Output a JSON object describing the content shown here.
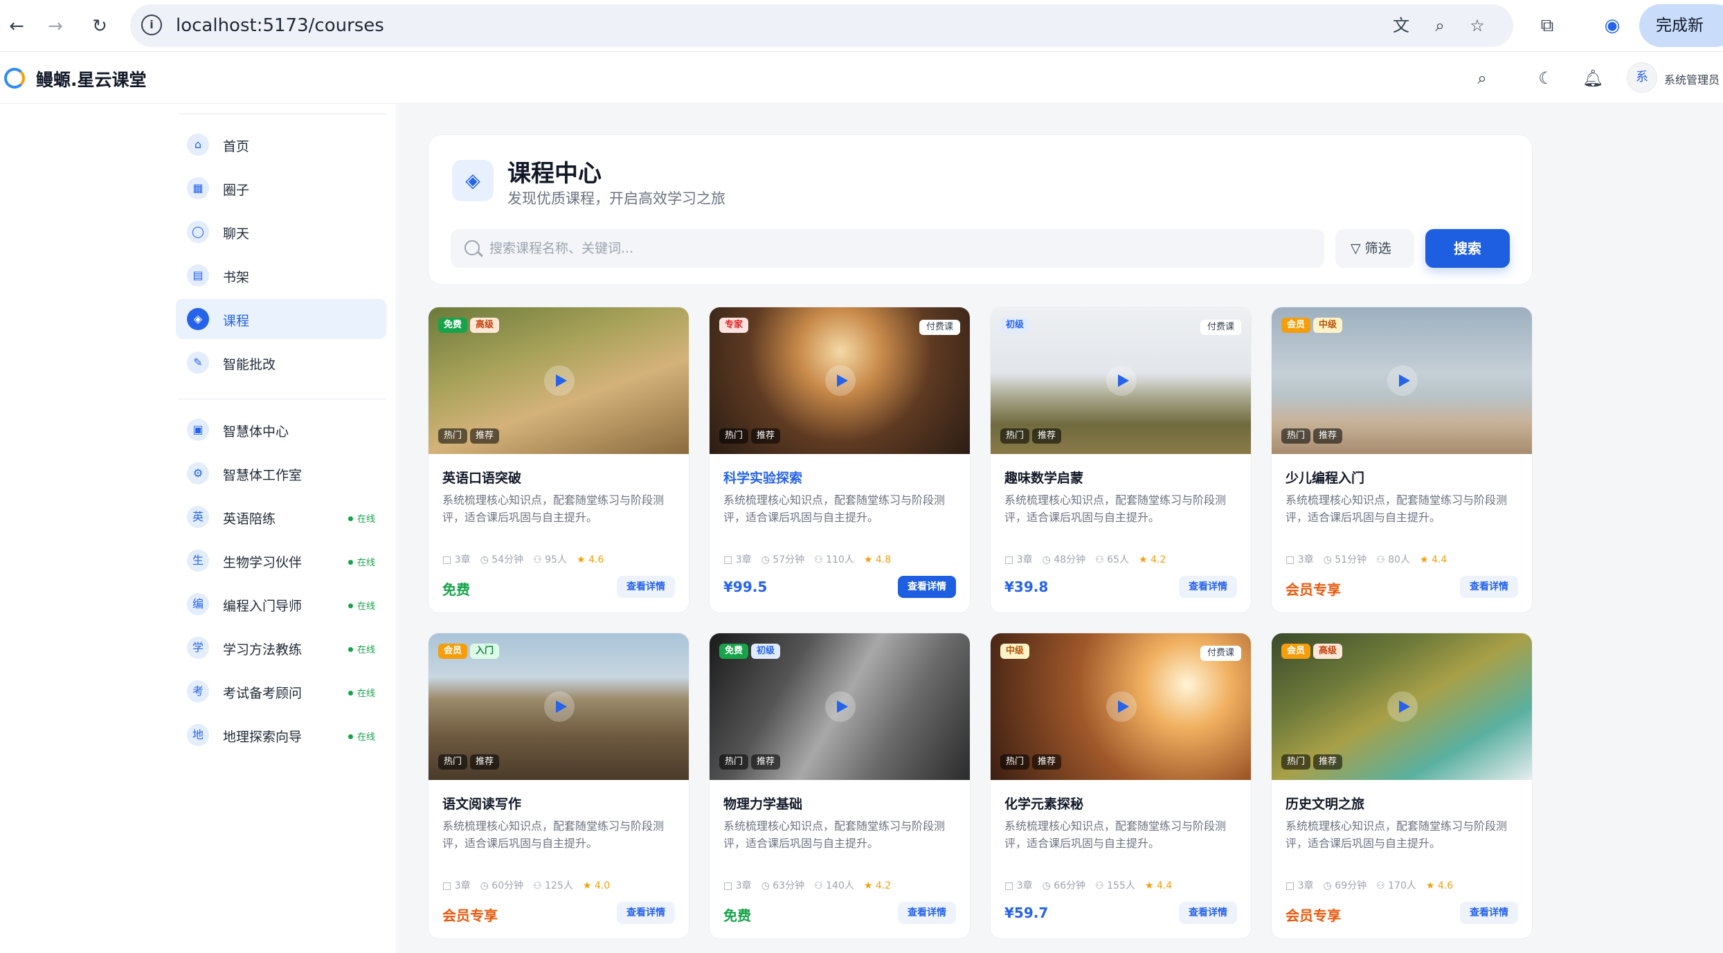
{
  "browser": {
    "url": "localhost:5173/courses",
    "update_label": "完成新"
  },
  "app": {
    "brand": "鳗螈.星云课堂",
    "user_avatar": "系",
    "user_name": "系统管理员"
  },
  "sidebar": {
    "primary": [
      {
        "icon": "home-icon",
        "glyph": "⌂",
        "label": "首页"
      },
      {
        "icon": "grid-icon",
        "glyph": "▦",
        "label": "圈子"
      },
      {
        "icon": "chat-icon",
        "glyph": "◯",
        "label": "聊天"
      },
      {
        "icon": "book-icon",
        "glyph": "▤",
        "label": "书架"
      },
      {
        "icon": "graduation-cap-icon",
        "glyph": "◈",
        "label": "课程",
        "active": true
      },
      {
        "icon": "pen-icon",
        "glyph": "✎",
        "label": "智能批改"
      }
    ],
    "agents": [
      {
        "icon": "robot-icon",
        "glyph": "▣",
        "label": "智慧体中心"
      },
      {
        "icon": "sliders-icon",
        "glyph": "⚙",
        "label": "智慧体工作室"
      },
      {
        "glyph": "英",
        "label": "英语陪练",
        "status": "在线"
      },
      {
        "glyph": "生",
        "label": "生物学习伙伴",
        "status": "在线"
      },
      {
        "glyph": "编",
        "label": "编程入门导师",
        "status": "在线"
      },
      {
        "glyph": "学",
        "label": "学习方法教练",
        "status": "在线"
      },
      {
        "glyph": "考",
        "label": "考试备考顾问",
        "status": "在线"
      },
      {
        "glyph": "地",
        "label": "地理探索向导",
        "status": "在线"
      }
    ]
  },
  "hero": {
    "title": "课程中心",
    "subtitle": "发现优质课程，开启高效学习之旅",
    "search_placeholder": "搜索课程名称、关键词...",
    "filter_label": "筛选",
    "search_label": "搜索"
  },
  "courses": [
    {
      "title": "英语口语突破",
      "tags": [
        {
          "text": "免费",
          "kind": "free"
        },
        {
          "text": "高级",
          "kind": "adv"
        }
      ],
      "pay_tag": "",
      "hot": [
        "热门",
        "推荐"
      ],
      "desc": "系统梳理核心知识点，配套随堂练习与阶段测评，适合课后巩固与自主提升。",
      "chapters": "3章",
      "duration": "54分钟",
      "students": "95人",
      "rating": "4.6",
      "price": "免费",
      "price_kind": "free",
      "detail": "查看详情",
      "bg": "linear-gradient(160deg,#6b7a3a 0%,#a8a25a 35%,#d4b27a 60%,#8a6a3e 100%)"
    },
    {
      "title": "科学实验探索",
      "tags": [
        {
          "text": "专家",
          "kind": "expert"
        }
      ],
      "pay_tag": "付费课",
      "hot": [
        "热门",
        "推荐"
      ],
      "desc": "系统梳理核心知识点，配套随堂练习与阶段测评，适合课后巩固与自主提升。",
      "chapters": "3章",
      "duration": "57分钟",
      "students": "110人",
      "rating": "4.8",
      "price": "¥99.5",
      "price_kind": "num",
      "detail": "查看详情",
      "bg": "radial-gradient(circle at 50% 30%,#f5d9a6 0%,#c88a4a 25%,#5e3a22 55%,#2a1c14 100%)",
      "title_link": true,
      "detail_primary": true
    },
    {
      "title": "趣味数学启蒙",
      "tags": [
        {
          "text": "初级",
          "kind": "basic"
        }
      ],
      "pay_tag": "付费课",
      "hot": [
        "热门",
        "推荐"
      ],
      "desc": "系统梳理核心知识点，配套随堂练习与阶段测评，适合课后巩固与自主提升。",
      "chapters": "3章",
      "duration": "48分钟",
      "students": "65人",
      "rating": "4.2",
      "price": "¥39.8",
      "price_kind": "num",
      "detail": "查看详情",
      "bg": "linear-gradient(180deg,#eef0f3 0%,#e2e6ea 45%,#a7a48a 62%,#6f6a3e 80%,#8a7a48 100%)"
    },
    {
      "title": "少儿编程入门",
      "tags": [
        {
          "text": "会员",
          "kind": "vip"
        },
        {
          "text": "中级",
          "kind": "mid"
        }
      ],
      "pay_tag": "",
      "hot": [
        "热门",
        "推荐"
      ],
      "desc": "系统梳理核心知识点，配套随堂练习与阶段测评，适合课后巩固与自主提升。",
      "chapters": "3章",
      "duration": "51分钟",
      "students": "80人",
      "rating": "4.4",
      "price": "会员专享",
      "price_kind": "vip",
      "detail": "查看详情",
      "bg": "linear-gradient(180deg,#9db0c0 0%,#c5cfd6 45%,#b9c4c9 60%,#c7b39a 78%,#a88c6e 100%)"
    },
    {
      "title": "语文阅读写作",
      "tags": [
        {
          "text": "会员",
          "kind": "vip"
        },
        {
          "text": "入门",
          "kind": "intro"
        }
      ],
      "pay_tag": "",
      "hot": [
        "热门",
        "推荐"
      ],
      "desc": "系统梳理核心知识点，配套随堂练习与阶段测评，适合课后巩固与自主提升。",
      "chapters": "3章",
      "duration": "60分钟",
      "students": "125人",
      "rating": "4.0",
      "price": "会员专享",
      "price_kind": "vip",
      "detail": "查看详情",
      "bg": "linear-gradient(180deg,#aac4d8 0%,#c8d6e0 30%,#9b8a6a 45%,#6e5a40 70%,#4a3a2a 100%)"
    },
    {
      "title": "物理力学基础",
      "tags": [
        {
          "text": "免费",
          "kind": "free"
        },
        {
          "text": "初级",
          "kind": "basic"
        }
      ],
      "pay_tag": "",
      "hot": [
        "热门",
        "推荐"
      ],
      "desc": "系统梳理核心知识点，配套随堂练习与阶段测评，适合课后巩固与自主提升。",
      "chapters": "3章",
      "duration": "63分钟",
      "students": "140人",
      "rating": "4.2",
      "price": "免费",
      "price_kind": "free",
      "detail": "查看详情",
      "bg": "linear-gradient(120deg,#1a1a1a 0%,#555 30%,#a8a8a8 50%,#6a6a6a 70%,#2a2a2a 100%)"
    },
    {
      "title": "化学元素探秘",
      "tags": [
        {
          "text": "中级",
          "kind": "mid"
        }
      ],
      "pay_tag": "付费课",
      "hot": [
        "热门",
        "推荐"
      ],
      "desc": "系统梳理核心知识点，配套随堂练习与阶段测评，适合课后巩固与自主提升。",
      "chapters": "3章",
      "duration": "66分钟",
      "students": "155人",
      "rating": "4.4",
      "price": "¥59.7",
      "price_kind": "num",
      "detail": "查看详情",
      "bg": "radial-gradient(circle at 75% 35%,#fff4d6 0%,#f0b060 20%,#a0582a 50%,#3a1e12 100%)"
    },
    {
      "title": "历史文明之旅",
      "tags": [
        {
          "text": "会员",
          "kind": "vip"
        },
        {
          "text": "高级",
          "kind": "adv"
        }
      ],
      "pay_tag": "",
      "hot": [
        "热门",
        "推荐"
      ],
      "desc": "系统梳理核心知识点，配套随堂练习与阶段测评，适合课后巩固与自主提升。",
      "chapters": "3章",
      "duration": "69分钟",
      "students": "170人",
      "rating": "4.6",
      "price": "会员专享",
      "price_kind": "vip",
      "detail": "查看详情",
      "bg": "linear-gradient(150deg,#3a4a2a 0%,#6e7a3a 30%,#a8a048 50%,#5ab0a0 75%,#e8eef0 100%)"
    }
  ]
}
